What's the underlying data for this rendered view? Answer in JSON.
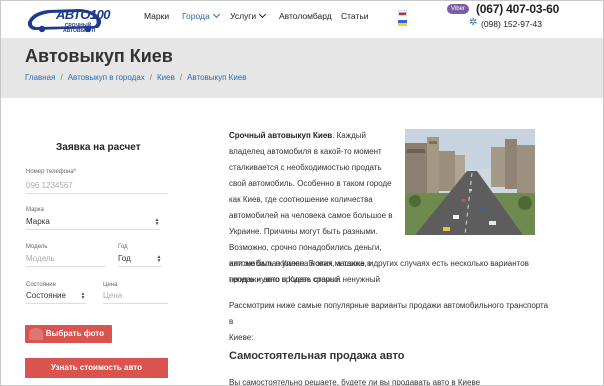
{
  "header": {
    "logo_text": "АВТО100",
    "logo_sub": "СРОЧНЫЙ АВТОВЫКУП",
    "nav": [
      {
        "label": "Марки",
        "active": false,
        "dropdown": false
      },
      {
        "label": "Города",
        "active": true,
        "dropdown": true
      },
      {
        "label": "Услуги",
        "active": false,
        "dropdown": true
      },
      {
        "label": "Автоломбард",
        "active": false,
        "dropdown": false
      },
      {
        "label": "Статьи",
        "active": false,
        "dropdown": false
      }
    ],
    "viber_label": "Viber",
    "phone_main": "(067) 407-03-60",
    "phone_alt": "(098) 152-97-43"
  },
  "banner": {
    "title": "Автовыкуп Киев",
    "breadcrumbs": [
      "Главная",
      "Автовыкуп в городах",
      "Киев",
      "Автовыкуп Киев"
    ]
  },
  "form": {
    "title": "Заявка на расчет",
    "phone_label": "Номер телефона*",
    "phone_placeholder": "096 1234567",
    "brand_label": "Марка",
    "brand_value": "Марка",
    "model_label": "Модель",
    "model_placeholder": "Модель",
    "year_label": "Год",
    "year_value": "Год",
    "condition_label": "Состояние",
    "condition_value": "Состояние",
    "price_label": "Цена",
    "price_placeholder": "Цена",
    "photo_button": "Выбрать фото",
    "cost_button": "Узнать стоимость авто"
  },
  "article": {
    "lead": "Срочный автовыкуп Киев",
    "para1_lines": [
      "Срочный автовыкуп Киев. Каждый",
      "владелец автомобиля в какой-то момент",
      "сталкивается с необходимостью продать",
      "свой автомобиль. Особенно в таком городе",
      "как Киев, где соотношение количества",
      "автомобилей на человека самое большое в",
      "Украине. Причины могут быть разными.",
      "Возможно, срочно понадобились деньги,",
      "или же была куплена новая машина, и",
      "теперь нужно продать старый ненужный"
    ],
    "para1_tail_lines": [
      "автомобиль в Киеве. В этих, а также в других случаях есть несколько вариантов",
      "продажи авто в Киеве срочно."
    ],
    "para2_lines": [
      "Рассмотрим ниже самые популярные варианты продажи автомобильного транспорта в",
      "Киеве:"
    ],
    "heading": "Самостоятельная продажа авто",
    "para3": "Вы самостоятельно решаете, будете ли вы продавать авто в Киеве"
  },
  "colors": {
    "accent_blue": "#2b6cb0",
    "button_red": "#d9534f",
    "banner_bg": "#e6e6e6",
    "viber": "#7b5ea7"
  }
}
